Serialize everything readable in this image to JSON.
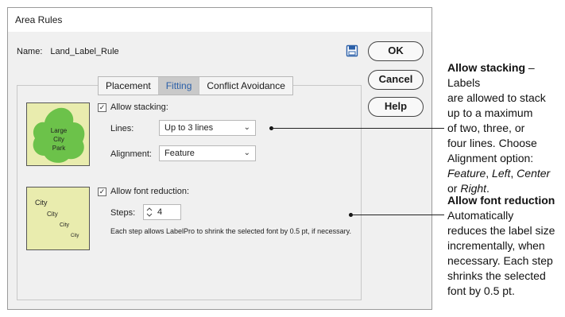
{
  "dialog": {
    "title": "Area Rules",
    "name_label": "Name:",
    "name_value": "Land_Label_Rule",
    "save_icon": "save-icon",
    "buttons": {
      "ok": "OK",
      "cancel": "Cancel",
      "help": "Help"
    }
  },
  "tabs": [
    {
      "label": "Placement",
      "active": false
    },
    {
      "label": "Fitting",
      "active": true
    },
    {
      "label": "Conflict Avoidance",
      "active": false
    }
  ],
  "thumb1": {
    "lines": [
      "Large",
      "City",
      "Park"
    ],
    "fill": "#6cc24a",
    "bg": "#e9ecae"
  },
  "thumb2": {
    "lines": [
      "City",
      "City",
      "City",
      "City"
    ]
  },
  "stacking": {
    "checkbox_label": "Allow stacking:",
    "checked": true,
    "lines_label": "Lines:",
    "lines_value": "Up to 3 lines",
    "alignment_label": "Alignment:",
    "alignment_value": "Feature"
  },
  "font_reduction": {
    "checkbox_label": "Allow font reduction:",
    "checked": true,
    "steps_label": "Steps:",
    "steps_value": "4",
    "description": "Each step allows LabelPro to shrink the selected font by 0.5 pt, if necessary."
  },
  "annotations": {
    "stacking": {
      "title": "Allow stacking",
      "dash": " – ",
      "line1_rest": "Labels",
      "line2": "are allowed to stack",
      "line3": "up to a maximum",
      "line4": "of two, three, or",
      "line5": "four lines. Choose",
      "line6": "Alignment option:",
      "opt_feature": "Feature",
      "opt_left": "Left",
      "opt_center": "Center",
      "comma": ", ",
      "or": "or ",
      "opt_right": "Right",
      "period": "."
    },
    "font": {
      "title": "Allow font reduction",
      "lines": [
        "Automatically",
        "reduces the label size",
        "incrementally, when",
        "necessary. Each step",
        "shrinks the selected",
        "font by 0.5 pt."
      ]
    }
  },
  "colors": {
    "accent": "#2a5fa8",
    "park": "#6cc24a",
    "thumb_bg": "#e9ecae"
  }
}
